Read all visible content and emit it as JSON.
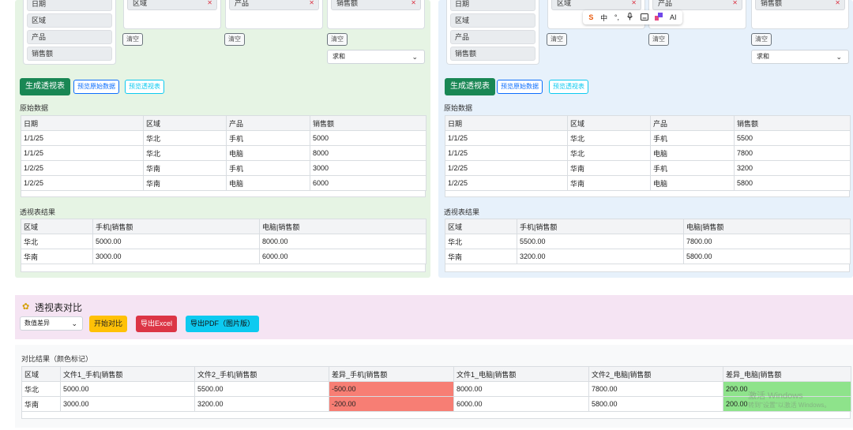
{
  "left": {
    "fields": [
      "日期",
      "区域",
      "产品",
      "销售额"
    ],
    "zones": [
      {
        "tag": "区域",
        "clear": "清空"
      },
      {
        "tag": "产品",
        "clear": "清空"
      },
      {
        "tag": "销售额",
        "clear": "清空"
      }
    ],
    "aggregate": "求和",
    "buttons": {
      "generate": "生成透视表",
      "preview_raw": "预览原始数据",
      "preview_pivot": "预览透视表"
    },
    "raw_label": "原始数据",
    "raw_headers": [
      "日期",
      "区域",
      "产品",
      "销售额"
    ],
    "raw_rows": [
      [
        "1/1/25",
        "华北",
        "手机",
        "5000"
      ],
      [
        "1/1/25",
        "华北",
        "电脑",
        "8000"
      ],
      [
        "1/2/25",
        "华南",
        "手机",
        "3000"
      ],
      [
        "1/2/25",
        "华南",
        "电脑",
        "6000"
      ]
    ],
    "pivot_label": "透视表结果",
    "pivot_headers": [
      "区域",
      "手机|销售额",
      "电脑|销售额"
    ],
    "pivot_rows": [
      [
        "华北",
        "5000.00",
        "8000.00"
      ],
      [
        "华南",
        "3000.00",
        "6000.00"
      ]
    ]
  },
  "right": {
    "fields": [
      "日期",
      "区域",
      "产品",
      "销售额"
    ],
    "zones": [
      {
        "tag": "区域",
        "clear": "清空"
      },
      {
        "tag": "产品",
        "clear": "清空"
      },
      {
        "tag": "销售额",
        "clear": "清空"
      }
    ],
    "aggregate": "求和",
    "buttons": {
      "generate": "生成透视表",
      "preview_raw": "预览原始数据",
      "preview_pivot": "预览透视表"
    },
    "raw_label": "原始数据",
    "raw_headers": [
      "日期",
      "区域",
      "产品",
      "销售额"
    ],
    "raw_rows": [
      [
        "1/1/25",
        "华北",
        "手机",
        "5500"
      ],
      [
        "1/1/25",
        "华北",
        "电脑",
        "7800"
      ],
      [
        "1/2/25",
        "华南",
        "手机",
        "3200"
      ],
      [
        "1/2/25",
        "华南",
        "电脑",
        "5800"
      ]
    ],
    "pivot_label": "透视表结果",
    "pivot_headers": [
      "区域",
      "手机|销售额",
      "电脑|销售额"
    ],
    "pivot_rows": [
      [
        "华北",
        "5500.00",
        "7800.00"
      ],
      [
        "华南",
        "3200.00",
        "5800.00"
      ]
    ]
  },
  "compare": {
    "title": "透视表对比",
    "mode": "数值差异",
    "start_button": "开始对比",
    "export_excel": "导出Excel",
    "export_pdf": "导出PDF（图片版）",
    "colors": {
      "start": "#ffc107",
      "excel": "#dc3545",
      "pdf": "#0dcaf0"
    }
  },
  "result": {
    "label": "对比结果（颜色标记）",
    "headers": [
      "区域",
      "文件1_手机|销售额",
      "文件2_手机|销售额",
      "差异_手机|销售额",
      "文件1_电脑|销售额",
      "文件2_电脑|销售额",
      "差异_电脑|销售额"
    ],
    "rows": [
      [
        "华北",
        "5000.00",
        "5500.00",
        "-500.00",
        "8000.00",
        "7800.00",
        "200.00"
      ],
      [
        "华南",
        "3000.00",
        "3200.00",
        "-200.00",
        "6000.00",
        "5800.00",
        "200.00"
      ]
    ],
    "colors": {
      "negative": "#f77e74",
      "positive": "#8ee38b"
    }
  },
  "ime_toolbar": {
    "items": [
      "S",
      "中",
      "°,",
      "mic-icon",
      "keyboard-icon",
      "skin-icon",
      "AI"
    ]
  },
  "watermark": {
    "line1": "激活 Windows",
    "line2": "转到\"设置\"以激活 Windows。"
  }
}
